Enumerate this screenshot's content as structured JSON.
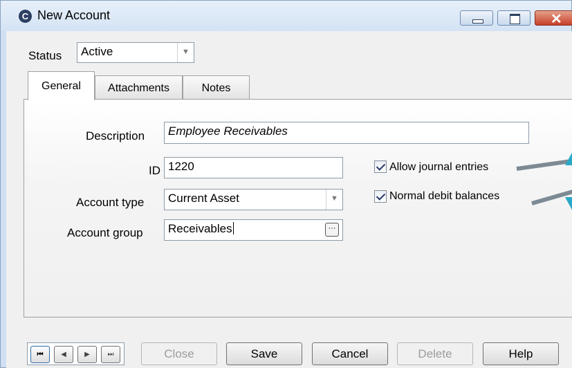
{
  "window": {
    "title": "New Account",
    "icon": "app-logo-icon",
    "controls": [
      "minimize-icon",
      "maximize-icon",
      "close-icon"
    ]
  },
  "status": {
    "label": "Status",
    "value": "Active"
  },
  "tabs": [
    {
      "label": "General",
      "active": true
    },
    {
      "label": "Attachments",
      "active": false
    },
    {
      "label": "Notes",
      "active": false
    }
  ],
  "form": {
    "description": {
      "label": "Description",
      "value": "Employee Receivables"
    },
    "id": {
      "label": "ID",
      "value": "1220"
    },
    "account_type": {
      "label": "Account type",
      "value": "Current Asset"
    },
    "account_group": {
      "label": "Account group",
      "value": "Receivables"
    },
    "allow_journal": {
      "label": "Allow journal entries",
      "checked": true
    },
    "normal_debit": {
      "label": "Normal debit balances",
      "checked": true
    }
  },
  "navigation": {
    "first": "⏮",
    "prev": "◀",
    "next": "▶",
    "last": "⏭"
  },
  "buttons": {
    "close": "Close",
    "save": "Save",
    "cancel": "Cancel",
    "delete": "Delete",
    "help": "Help"
  },
  "colors": {
    "titlebar": "#d3e3f4",
    "close_button": "#c6402a",
    "callout_teal": "#2aa8c8"
  }
}
